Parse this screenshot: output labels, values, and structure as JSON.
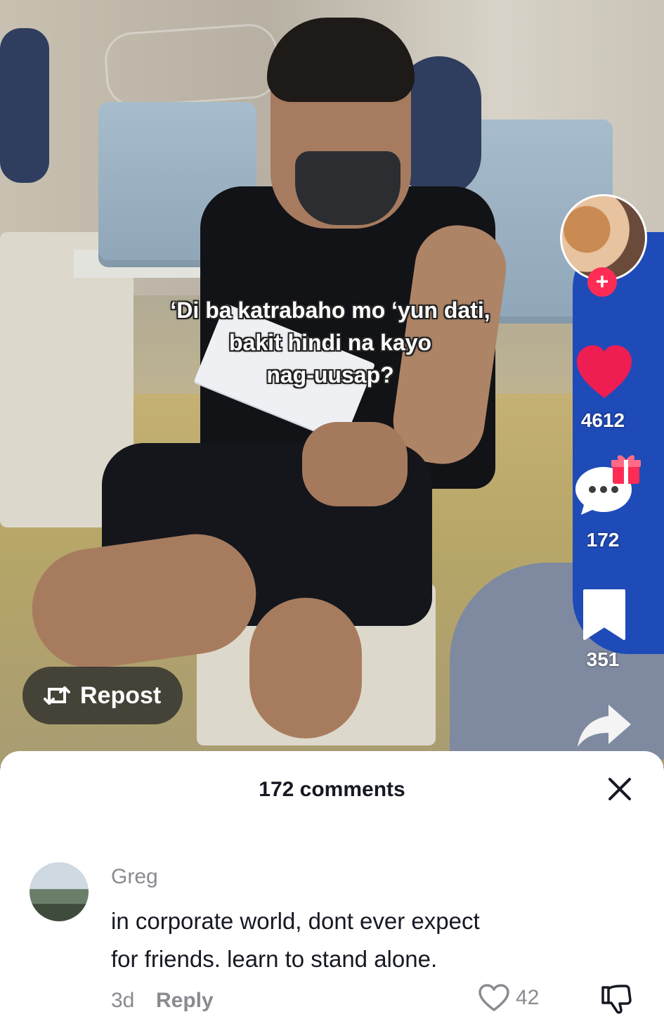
{
  "video": {
    "caption_lines": [
      "‘Di ba katrabaho mo ‘yun dati,",
      "bakit hindi na kayo",
      "nag-uusap?"
    ]
  },
  "rail": {
    "follow_symbol": "+",
    "likes": "4612",
    "comments": "172",
    "saves": "351",
    "icons": [
      "creator-avatar",
      "heart-icon",
      "comment-icon",
      "gift-icon",
      "bookmark-icon",
      "share-icon"
    ]
  },
  "repost": {
    "label": "Repost",
    "icon": "repost-icon"
  },
  "comments_sheet": {
    "title": "172 comments",
    "close_icon": "close-icon",
    "items": [
      {
        "author": "Greg",
        "text_lines": [
          "in corporate world, dont ever expect",
          "for friends. learn to stand alone."
        ],
        "time": "3d",
        "reply_label": "Reply",
        "likes": "42"
      }
    ]
  },
  "colors": {
    "accent": "#fe2c55",
    "heart": "#ee1d52",
    "muted": "#8a8b91",
    "text": "#161823"
  }
}
